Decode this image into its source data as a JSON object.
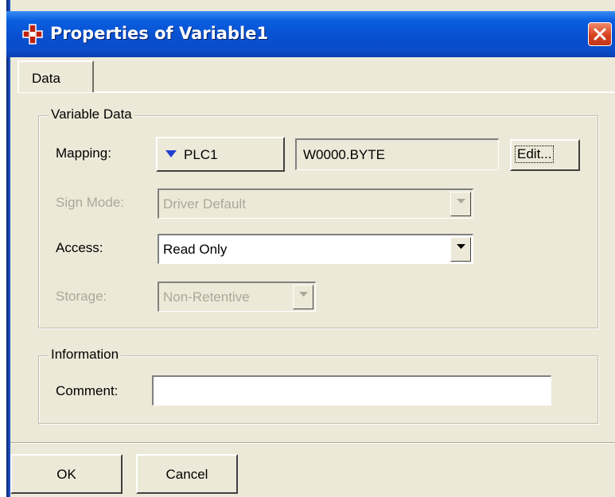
{
  "window": {
    "title": "Properties of Variable1",
    "icon": "variable-properties-icon",
    "close_icon": "close-icon"
  },
  "tabs": [
    {
      "label": "Data",
      "selected": true
    }
  ],
  "variable_data": {
    "legend": "Variable Data",
    "mapping": {
      "label": "Mapping:",
      "device_button": "PLC1",
      "address_value": "W0000.BYTE",
      "edit_button": "Edit..."
    },
    "sign_mode": {
      "label": "Sign Mode:",
      "value": "Driver Default",
      "enabled": false
    },
    "access": {
      "label": "Access:",
      "value": "Read Only",
      "enabled": true
    },
    "storage": {
      "label": "Storage:",
      "value": "Non-Retentive",
      "enabled": false
    }
  },
  "information": {
    "legend": "Information",
    "comment": {
      "label": "Comment:",
      "value": ""
    }
  },
  "footer": {
    "ok_label": "OK",
    "cancel_label": "Cancel"
  },
  "colors": {
    "titlebar": "#0a5fe0",
    "dialog_bg": "#ece9d8",
    "disabled_text": "#aca899",
    "close_button": "#d8421e",
    "dropdown_arrow": "#1f3fd0"
  }
}
